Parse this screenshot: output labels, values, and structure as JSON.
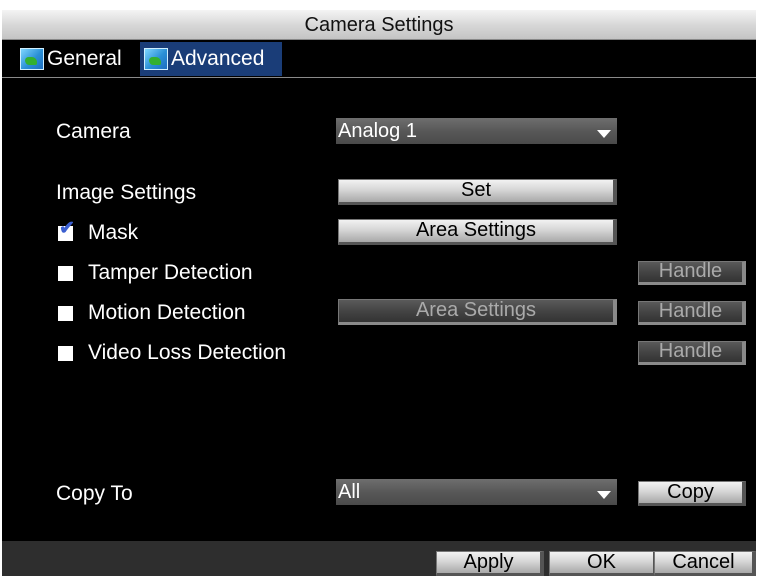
{
  "window": {
    "title": "Camera Settings"
  },
  "tabs": [
    {
      "label": "General",
      "active": false,
      "icon": "camera-icon"
    },
    {
      "label": "Advanced",
      "active": true,
      "icon": "camera-icon"
    }
  ],
  "fields": {
    "camera_label": "Camera",
    "camera_value": "Analog 1",
    "image_settings_label": "Image Settings",
    "image_settings_button": "Set",
    "mask_label": "Mask",
    "mask_checked": true,
    "mask_button": "Area Settings",
    "tamper_label": "Tamper Detection",
    "tamper_checked": false,
    "tamper_handle": "Handle",
    "motion_label": "Motion Detection",
    "motion_checked": false,
    "motion_button": "Area Settings",
    "motion_handle": "Handle",
    "video_loss_label": "Video Loss Detection",
    "video_loss_checked": false,
    "video_loss_handle": "Handle",
    "copy_to_label": "Copy To",
    "copy_to_value": "All",
    "copy_button": "Copy"
  },
  "footer": {
    "apply": "Apply",
    "ok": "OK",
    "cancel": "Cancel"
  },
  "colors": {
    "background": "#000000",
    "active_tab": "#1a3d78",
    "footer": "#2e2e2e",
    "checkmark": "#3b5fd0"
  }
}
